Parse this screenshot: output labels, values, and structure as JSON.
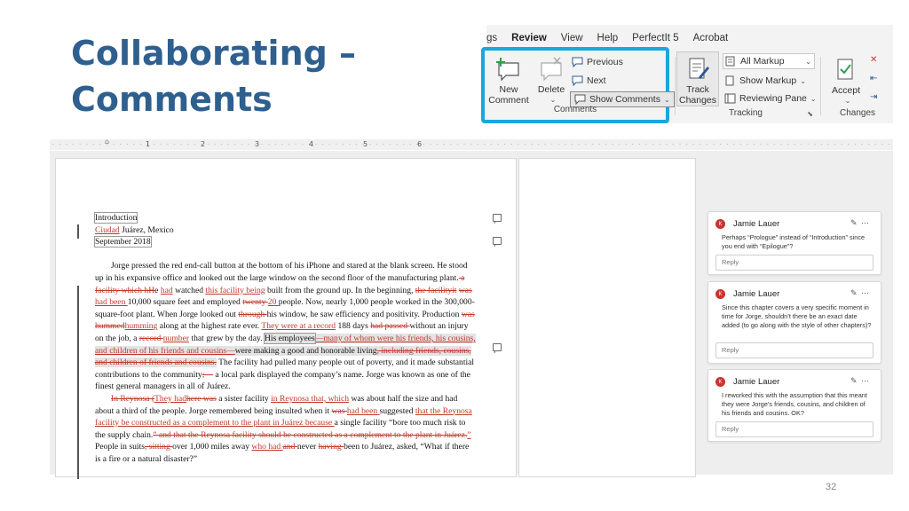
{
  "slide": {
    "title_line1": "Collaborating –",
    "title_line2": "Comments",
    "page_number": "32"
  },
  "ribbon": {
    "tabs": [
      "gs",
      "Review",
      "View",
      "Help",
      "PerfectIt 5",
      "Acrobat"
    ],
    "active_tab": "Review",
    "comments_group": {
      "label": "Comments",
      "new_comment": "New Comment",
      "delete": "Delete",
      "previous": "Previous",
      "next": "Next",
      "show_comments": "Show Comments"
    },
    "tracking_group": {
      "label": "Tracking",
      "track_changes": "Track Changes",
      "all_markup": "All Markup",
      "show_markup": "Show Markup",
      "reviewing_pane": "Reviewing Pane"
    },
    "changes_group": {
      "label": "Changes",
      "accept": "Accept"
    },
    "highlight_color": "#1aa7dc"
  },
  "ruler": {
    "marks": [
      "1",
      "2",
      "3",
      "4",
      "5",
      "6"
    ]
  },
  "document": {
    "heading": "Introduction",
    "place_ins": "Ciudad",
    "place_rest": " Juárez, Mexico",
    "date": "September 2018",
    "p1": {
      "a": "Jorge pressed the red end-call button at the bottom of his iPhone and stared at the blank screen. He stood up in his expansive office and looked out the large window on the second floor of the manufacturing plant.",
      "b": " a facility which hH",
      "c": "e ",
      "d": "had",
      "e": " watched ",
      "f": "this facility being",
      "g": " built from the ground up. In the beginning, ",
      "h": "the facilityit",
      "i": " ",
      "j": "was",
      "k": " ",
      "l": "had been ",
      "m": "10,000 square feet and employed ",
      "n": "twenty ",
      "o": "20 ",
      "p": "people. Now, nearly 1,000 people worked in the 300,000-square-foot plant. When Jorge looked out ",
      "q": "through ",
      "r": "his window, he saw efficiency and positivity. Production ",
      "s": "was hummed",
      "t": "humming",
      "u": " along at the highest rate ever. ",
      "v": "They were at a record",
      "w": " 188 days ",
      "x": "had passed ",
      "y": "without an injury on the job, a ",
      "z": "record ",
      "aa": "number",
      "ab": " that grew by the day. ",
      "ac": "His employees",
      "ad": "—many of whom were his friends, his cousins, and children of his friends and cousins—",
      "ae": "were making a good and honorable living",
      "af": ", including friends, cousins, and children of friends and cousins.",
      "ag": " The facility had pulled many people out of poverty, and it made substantial contributions to the community",
      "ah": ";—",
      "ai": " a local park displayed the company’s name. Jorge was known as one of the finest general managers in all of Juárez."
    },
    "p2": {
      "a": "In Reynosa (",
      "b": "They had",
      "c": "here was",
      "d": " a sister facility ",
      "e": "in Reynosa that, which",
      "f": " was about half the size and had about a third of the people. Jorge remembered being insulted when it ",
      "g": "was ",
      "h": "had been ",
      "i": "suggested ",
      "j": "that the Reynosa facility be constructed as a complement to the plant in Juárez because ",
      "k": "a single facility “bore too much risk to the supply chain.",
      "l": "” and that the Reynosa facility should be constructed as a complement to the plant in Juárez.",
      "m": "”",
      "n": " People in suits",
      "o": ", sitting ",
      "p": "over 1,000 miles away ",
      "q": "who had ",
      "r": "and ",
      "s": "never ",
      "t": "having ",
      "u": "been to Juárez",
      "v": ", asked, “What if there is a fire or a natural disaster?”"
    }
  },
  "comments": [
    {
      "initial": "K",
      "author": "Jamie Lauer",
      "text": "Perhaps “Prologue” instead of “Introduction” since you end with “Epilogue”?",
      "reply": "Reply"
    },
    {
      "initial": "K",
      "author": "Jamie Lauer",
      "text": "Since this chapter covers a very specific moment in time for Jorge, shouldn’t there be an exact date added (to go along with the style of other chapters)?",
      "reply": "Reply"
    },
    {
      "initial": "K",
      "author": "Jamie Lauer",
      "text": "I reworked this with the assumption that this meant they were Jorge’s friends, cousins, and children of his friends and cousins. OK?",
      "reply": "Reply"
    }
  ],
  "colors": {
    "title": "#2e5f8f",
    "revision": "#c0392b",
    "avatar": "#c8352e"
  }
}
